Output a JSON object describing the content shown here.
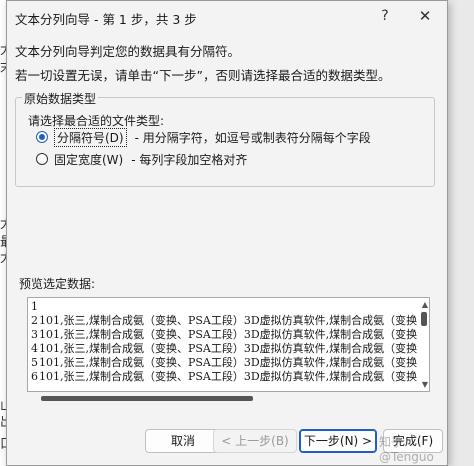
{
  "background": {
    "glyphs": [
      "大",
      "末",
      "大",
      "最",
      "大",
      "山",
      "出",
      "口"
    ]
  },
  "window": {
    "title": "文本分列向导 - 第 1 步，共 3 步",
    "help_glyph": "?",
    "close_glyph": "✕"
  },
  "intro": {
    "line1": "文本分列向导判定您的数据具有分隔符。",
    "line2": "若一切设置无误，请单击“下一步”，否则请选择最合适的数据类型。"
  },
  "group": {
    "title": "原始数据类型",
    "choose_label": "请选择最合适的文件类型:",
    "options": [
      {
        "label": "分隔符号(D)",
        "desc": "- 用分隔字符，如逗号或制表符分隔每个字段",
        "checked": true
      },
      {
        "label": "固定宽度(W)",
        "desc": "- 每列字段加空格对齐",
        "checked": false
      }
    ]
  },
  "preview": {
    "label": "预览选定数据:",
    "rows": [
      {
        "num": "1",
        "text": ""
      },
      {
        "num": "2",
        "text": "101,张三,煤制合成氨（变换、PSA工段）3D虚拟仿真软件,煤制合成氨（变换"
      },
      {
        "num": "3",
        "text": "101,张三,煤制合成氨（变换、PSA工段）3D虚拟仿真软件,煤制合成氨（变换"
      },
      {
        "num": "4",
        "text": "101,张三,煤制合成氨（变换、PSA工段）3D虚拟仿真软件,煤制合成氨（变换"
      },
      {
        "num": "5",
        "text": "101,张三,煤制合成氨（变换、PSA工段）3D虚拟仿真软件,煤制合成氨（变换"
      },
      {
        "num": "6",
        "text": "101,张三,煤制合成氨（变换、PSA工段）3D虚拟仿真软件,煤制合成氨（变换"
      }
    ]
  },
  "buttons": {
    "cancel": "取消",
    "back": "< 上一步(B)",
    "next": "下一步(N) >",
    "finish": "完成(F)"
  },
  "watermark": "知乎 @Tenguo"
}
